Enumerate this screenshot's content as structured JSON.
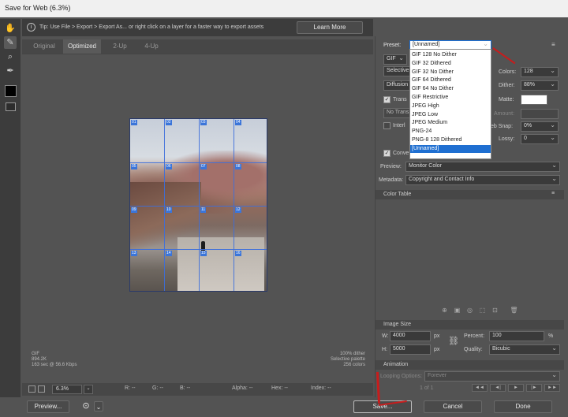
{
  "window": {
    "title": "Save for Web (6.3%)"
  },
  "tip": {
    "text": "Tip: Use File > Export > Export As... or right click on a layer for a faster way to export assets",
    "learn_more": "Learn More"
  },
  "tabs": [
    {
      "label": "Original"
    },
    {
      "label": "Optimized"
    },
    {
      "label": "2-Up"
    },
    {
      "label": "4-Up"
    }
  ],
  "slices": [
    "01",
    "02",
    "03",
    "04",
    "05",
    "06",
    "07",
    "08",
    "09",
    "10",
    "11",
    "12",
    "13",
    "14",
    "15",
    "16"
  ],
  "image_info": {
    "left": [
      "GIF",
      "894.2K",
      "163 sec @ 56.6 Kbps"
    ],
    "right": [
      "100% dither",
      "Selective palette",
      "256 colors"
    ]
  },
  "status": {
    "zoom": "6.3%",
    "r": "R: --",
    "g": "G: --",
    "b": "B: --",
    "alpha": "Alpha: --",
    "hex": "Hex: --",
    "index": "Index: --"
  },
  "panel": {
    "preset_label": "Preset:",
    "preset_value": "[Unnamed]",
    "preset_options": [
      "GIF 128 No Dither",
      "GIF 32 Dithered",
      "GIF 32 No Dither",
      "GIF 64 Dithered",
      "GIF 64 No Dither",
      "GIF Restrictive",
      "JPEG High",
      "JPEG Low",
      "JPEG Medium",
      "PNG-24",
      "PNG-8 128 Dithered",
      "[Unnamed]"
    ],
    "format": "GIF",
    "reduction": "Selective",
    "dither_algo": "Diffusion",
    "transparency": "Trans",
    "no_transparency": "No Trans",
    "interlaced": "Interl",
    "convert": "Conve",
    "colors_label": "Colors:",
    "colors_value": "128",
    "dither_label": "Dither:",
    "dither_value": "88%",
    "matte_label": "Matte:",
    "amount_label": "Amount:",
    "websnap_label": "eb Snap:",
    "websnap_value": "0%",
    "lossy_label": "Lossy:",
    "lossy_value": "0",
    "preview_label": "Preview:",
    "preview_value": "Monitor Color",
    "metadata_label": "Metadata:",
    "metadata_value": "Copyright and Contact Info",
    "color_table": "Color Table",
    "image_size": "Image Size",
    "w_label": "W:",
    "w_value": "4000",
    "h_label": "H:",
    "h_value": "5000",
    "px": "px",
    "percent_label": "Percent:",
    "percent_value": "100",
    "pct": "%",
    "quality_label": "Quality:",
    "quality_value": "Bicubic",
    "animation": "Animation",
    "looping_label": "Looping Options:",
    "looping_value": "Forever",
    "frame": "1 of 1"
  },
  "buttons": {
    "preview": "Preview...",
    "save": "Save...",
    "cancel": "Cancel",
    "done": "Done"
  },
  "colors": {
    "accent": "#1f6fd1",
    "arrow": "#c71c1c"
  }
}
